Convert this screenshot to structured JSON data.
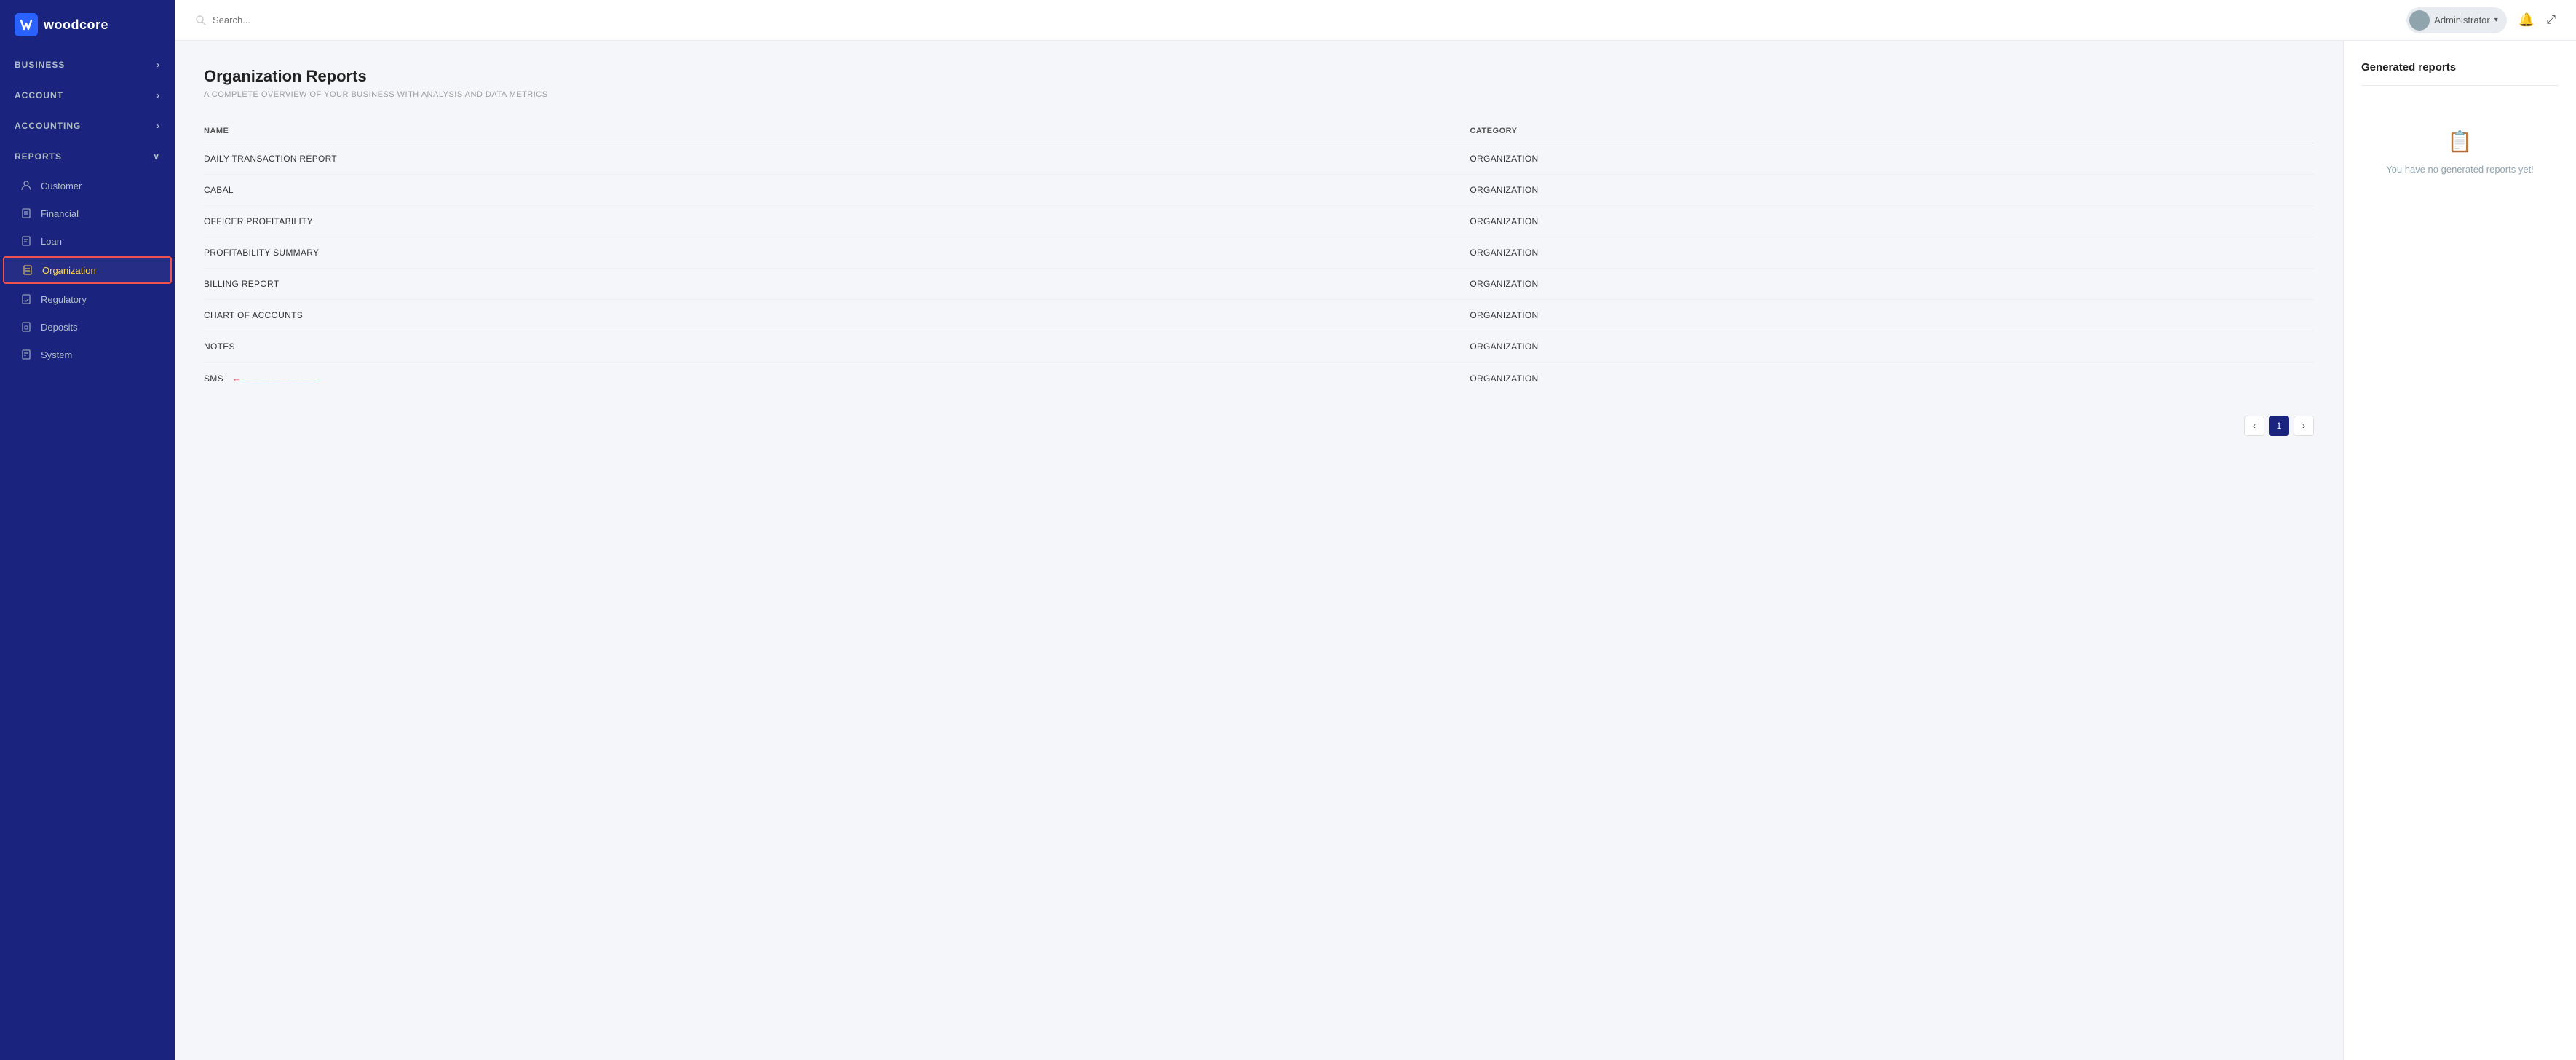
{
  "brand": {
    "name": "woodcore",
    "logo_char": "W"
  },
  "sidebar": {
    "nav_items": [
      {
        "label": "BUSINESS",
        "has_chevron": true,
        "expanded": false
      },
      {
        "label": "ACCOUNT",
        "has_chevron": true,
        "expanded": false
      },
      {
        "label": "ACCOUNTING",
        "has_chevron": true,
        "expanded": false
      },
      {
        "label": "REPORTS",
        "has_chevron": true,
        "expanded": true
      }
    ],
    "sub_items": [
      {
        "label": "Customer",
        "icon": "person",
        "active": false
      },
      {
        "label": "Financial",
        "icon": "file",
        "active": false
      },
      {
        "label": "Loan",
        "icon": "file-text",
        "active": false
      },
      {
        "label": "Organization",
        "icon": "building",
        "active": true
      },
      {
        "label": "Regulatory",
        "icon": "file-check",
        "active": false
      },
      {
        "label": "Deposits",
        "icon": "file-lock",
        "active": false
      },
      {
        "label": "System",
        "icon": "settings",
        "active": false
      }
    ]
  },
  "header": {
    "search_placeholder": "Search...",
    "user_name": "Administrator",
    "notification_icon": "bell",
    "expand_icon": "expand"
  },
  "main": {
    "page_title": "Organization Reports",
    "page_subtitle": "A COMPLETE OVERVIEW OF YOUR BUSINESS WITH ANALYSIS AND DATA METRICS",
    "table": {
      "columns": [
        "NAME",
        "CATEGORY"
      ],
      "rows": [
        {
          "name": "DAILY TRANSACTION REPORT",
          "category": "ORGANIZATION"
        },
        {
          "name": "CABAL",
          "category": "ORGANIZATION"
        },
        {
          "name": "OFFICER PROFITABILITY",
          "category": "ORGANIZATION"
        },
        {
          "name": "PROFITABILITY SUMMARY",
          "category": "ORGANIZATION"
        },
        {
          "name": "BILLING REPORT",
          "category": "ORGANIZATION"
        },
        {
          "name": "CHART OF ACCOUNTS",
          "category": "ORGANIZATION"
        },
        {
          "name": "NOTES",
          "category": "ORGANIZATION"
        },
        {
          "name": "SMS",
          "category": "ORGANIZATION",
          "has_arrow": true
        }
      ]
    },
    "pagination": {
      "prev_label": "‹",
      "next_label": "›",
      "current_page": 1,
      "pages": [
        1
      ]
    }
  },
  "right_panel": {
    "title": "Generated reports",
    "no_reports_text": "You have no generated reports yet!",
    "no_reports_icon": "📋"
  }
}
